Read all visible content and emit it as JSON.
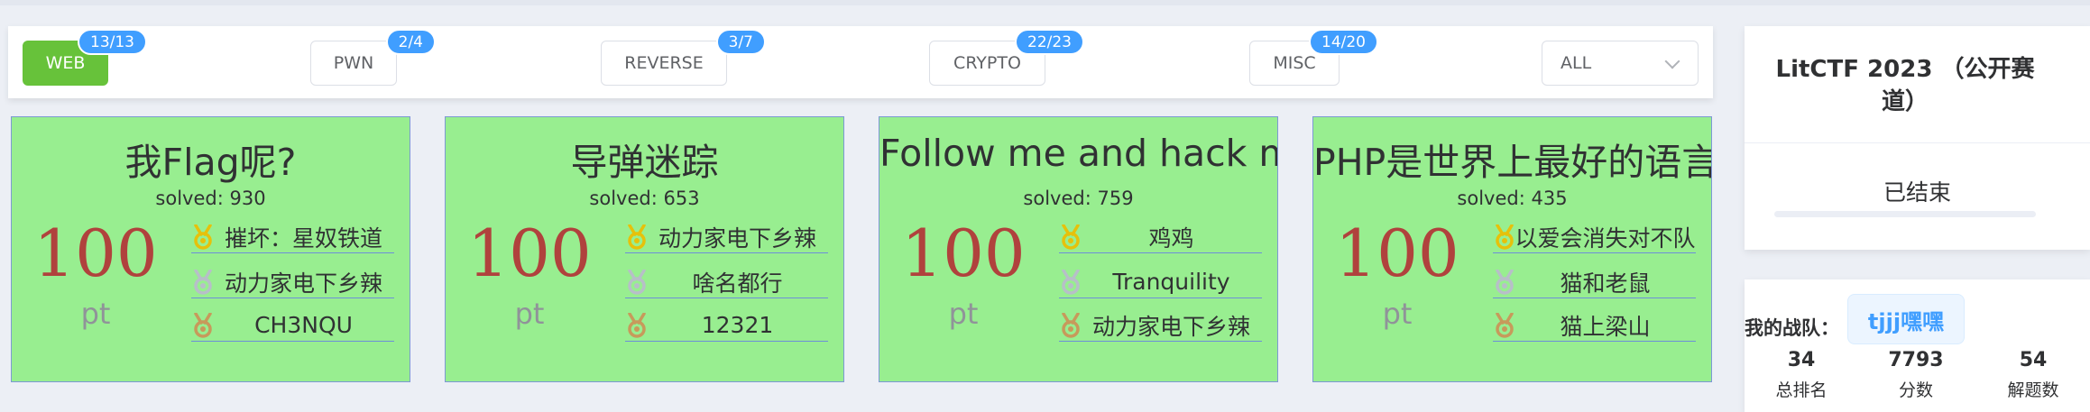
{
  "categories": [
    {
      "label": "WEB",
      "badge": "13/13",
      "active": true
    },
    {
      "label": "PWN",
      "badge": "2/4",
      "active": false
    },
    {
      "label": "REVERSE",
      "badge": "3/7",
      "active": false
    },
    {
      "label": "CRYPTO",
      "badge": "22/23",
      "active": false
    },
    {
      "label": "MISC",
      "badge": "14/20",
      "active": false
    }
  ],
  "filter": {
    "value": "ALL"
  },
  "challenges": [
    {
      "title": "我Flag呢?",
      "solved": "solved: 930",
      "points": "100",
      "unit": "pt",
      "ranks": [
        {
          "medal": "gold-medal-icon",
          "name": "摧坏：星奴铁道"
        },
        {
          "medal": "silver-medal-icon",
          "name": "动力家电下乡辣"
        },
        {
          "medal": "bronze-medal-icon",
          "name": "CH3NQU"
        }
      ]
    },
    {
      "title": "导弹迷踪",
      "solved": "solved: 653",
      "points": "100",
      "unit": "pt",
      "ranks": [
        {
          "medal": "gold-medal-icon",
          "name": "动力家电下乡辣"
        },
        {
          "medal": "silver-medal-icon",
          "name": "啥名都行"
        },
        {
          "medal": "bronze-medal-icon",
          "name": "12321"
        }
      ]
    },
    {
      "title": "Follow me and hack me",
      "solved": "solved: 759",
      "points": "100",
      "unit": "pt",
      "ranks": [
        {
          "medal": "gold-medal-icon",
          "name": "鸡鸡"
        },
        {
          "medal": "silver-medal-icon",
          "name": "Tranquility"
        },
        {
          "medal": "bronze-medal-icon",
          "name": "动力家电下乡辣"
        }
      ]
    },
    {
      "title": "PHP是世界上最好的语言!",
      "solved": "solved: 435",
      "points": "100",
      "unit": "pt",
      "ranks": [
        {
          "medal": "gold-medal-icon",
          "name": "以爱会消失对不队"
        },
        {
          "medal": "silver-medal-icon",
          "name": "猫和老鼠"
        },
        {
          "medal": "bronze-medal-icon",
          "name": "猫上梁山"
        }
      ]
    }
  ],
  "contest": {
    "title": "LitCTF 2023 （公开赛道）",
    "status": "已结束"
  },
  "team": {
    "label": "我的战队：",
    "name": "tjjj嘿嘿",
    "stats": [
      {
        "value": "34",
        "label": "总排名"
      },
      {
        "value": "7793",
        "label": "分数"
      },
      {
        "value": "54",
        "label": "解题数"
      }
    ]
  },
  "colors": {
    "accent": "#409eff",
    "active_tab": "#67c23a",
    "card_bg": "#98ee90",
    "points": "#b0423d",
    "gold": "#e6c10b",
    "silver": "#b7bfc8",
    "bronze": "#c79a5b"
  }
}
